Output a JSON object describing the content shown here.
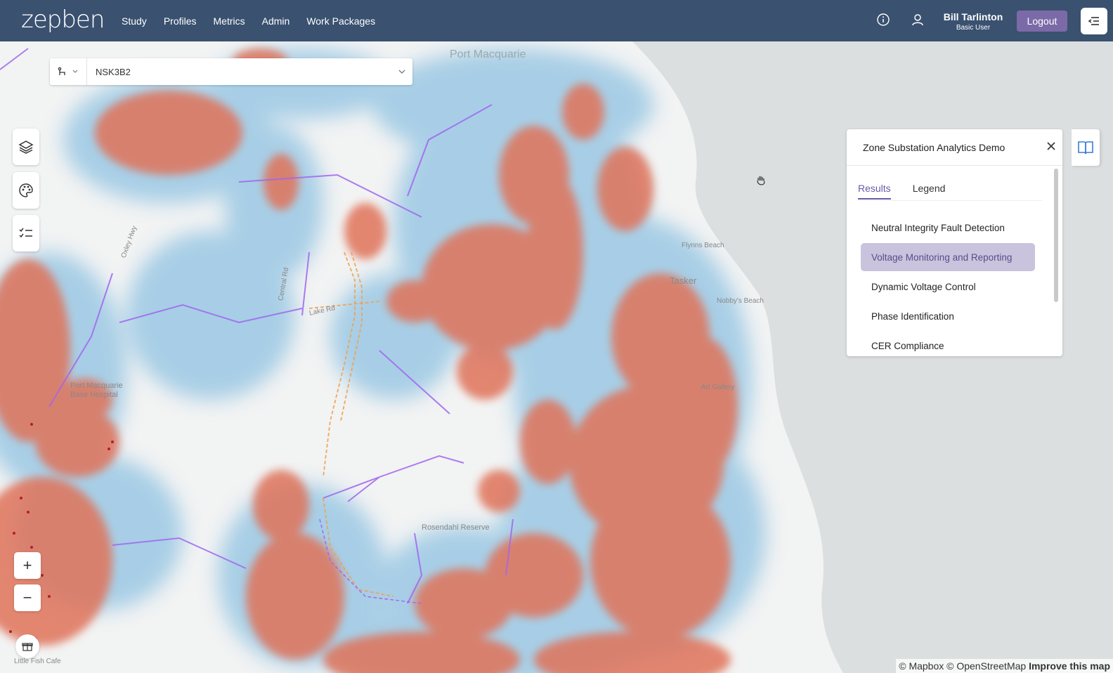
{
  "app": {
    "logo": "zepben",
    "nav": [
      "Study",
      "Profiles",
      "Metrics",
      "Admin",
      "Work Packages"
    ],
    "user": {
      "name": "Bill Tarlinton",
      "role": "Basic User"
    },
    "logout_label": "Logout"
  },
  "colors": {
    "topbar": "#3a5170",
    "accent": "#7c6aa8",
    "heat_high": "#e07a5f",
    "heat_low": "#9fcbe4",
    "network_line": "#a066ee",
    "network_secondary": "#f0a050"
  },
  "search": {
    "value": "NSK3B2",
    "type_icon": "network-icon"
  },
  "map": {
    "labels": [
      "Port Macquarie",
      "Port Macquarie\nBase Hospital",
      "Oxley Hwy",
      "Lake Rd",
      "Rosendahl Reserve",
      "Tasker",
      "Flynns Beach",
      "Nobby's Beach",
      "Little Fish Cafe",
      "Central Rd",
      "Art Gallery"
    ],
    "attribution": {
      "mapbox": "© Mapbox",
      "osm": "© OpenStreetMap",
      "improve": "Improve this map"
    }
  },
  "panel": {
    "title": "Zone Substation Analytics Demo",
    "tabs": [
      "Results",
      "Legend"
    ],
    "active_tab": "Results",
    "items": [
      "Neutral Integrity Fault Detection",
      "Voltage Monitoring and Reporting",
      "Dynamic Voltage Control",
      "Phase Identification",
      "CER Compliance"
    ],
    "selected_item": "Voltage Monitoring and Reporting"
  },
  "zoom": {
    "in": "+",
    "out": "−"
  }
}
